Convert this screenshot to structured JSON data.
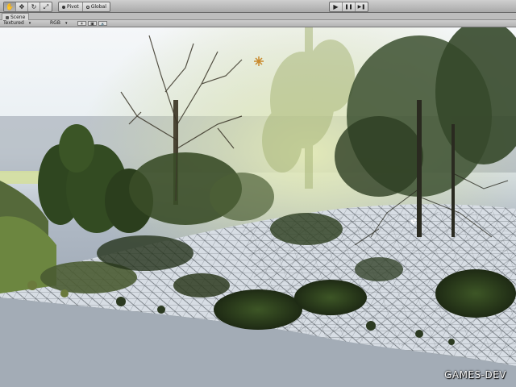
{
  "toolbar": {
    "tools": [
      {
        "name": "hand-tool",
        "glyph": "✋"
      },
      {
        "name": "move-tool",
        "glyph": "✥"
      },
      {
        "name": "rotate-tool",
        "glyph": "↻"
      },
      {
        "name": "scale-tool",
        "glyph": "⤢"
      }
    ],
    "pivot_label": "Pivot",
    "global_label": "Global",
    "play_glyph": "▶",
    "pause_glyph": "❚❚",
    "step_glyph": "▶❚"
  },
  "scene": {
    "tab_label": "Scene",
    "render_mode": "Textured",
    "color_mode": "RGB",
    "toggle_lighting_glyph": "☀",
    "toggle_effects_glyph": "▣",
    "toggle_audio_glyph": "🔊"
  },
  "viewport": {
    "watermark": "GAMES-DEV"
  },
  "colors": {
    "sky": "#e6edf3",
    "fog": "#cfd9a5",
    "terrain_mesh": "#c9d2dc",
    "foliage_dark": "#253019",
    "foliage_light": "#4a6a2e"
  }
}
